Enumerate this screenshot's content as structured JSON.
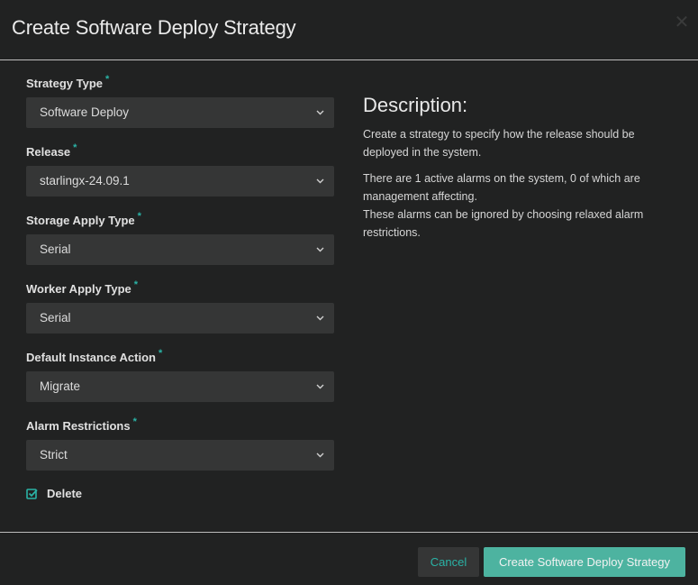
{
  "dialog": {
    "title": "Create Software Deploy Strategy",
    "close_icon": "close-icon"
  },
  "form": {
    "required_marker": "*",
    "fields": [
      {
        "label": "Strategy Type",
        "value": "Software Deploy"
      },
      {
        "label": "Release",
        "value": "starlingx-24.09.1"
      },
      {
        "label": "Storage Apply Type",
        "value": "Serial"
      },
      {
        "label": "Worker Apply Type",
        "value": "Serial"
      },
      {
        "label": "Default Instance Action",
        "value": "Migrate"
      },
      {
        "label": "Alarm Restrictions",
        "value": "Strict"
      }
    ],
    "delete_checkbox": {
      "label": "Delete",
      "checked": true
    }
  },
  "description": {
    "title": "Description:",
    "paragraph1": "Create a strategy to specify how the release should be deployed in the system.",
    "paragraph2_line1": "There are 1 active alarms on the system, 0 of which are management affecting.",
    "paragraph2_line2": "These alarms can be ignored by choosing relaxed alarm restrictions."
  },
  "footer": {
    "cancel_label": "Cancel",
    "submit_label": "Create Software Deploy Strategy"
  },
  "colors": {
    "accent": "#2ab3a6",
    "primary_button": "#4db3a0",
    "background": "#212222",
    "input_background": "#353636"
  }
}
